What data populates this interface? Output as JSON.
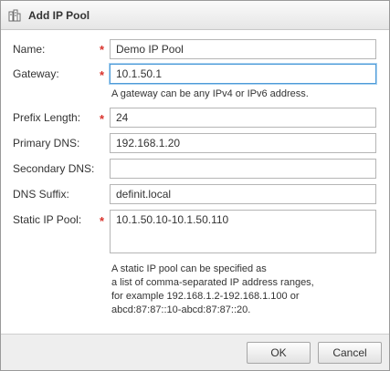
{
  "dialog": {
    "title": "Add IP Pool",
    "title_icon": "ip-pool-icon"
  },
  "form": {
    "name": {
      "label": "Name:",
      "required": true,
      "value": "Demo IP Pool"
    },
    "gateway": {
      "label": "Gateway:",
      "required": true,
      "value": "10.1.50.1",
      "hint": "A gateway can be any IPv4 or IPv6 address."
    },
    "prefix_length": {
      "label": "Prefix Length:",
      "required": true,
      "value": "24"
    },
    "primary_dns": {
      "label": "Primary DNS:",
      "required": false,
      "value": "192.168.1.20"
    },
    "secondary_dns": {
      "label": "Secondary DNS:",
      "required": false,
      "value": ""
    },
    "dns_suffix": {
      "label": "DNS Suffix:",
      "required": false,
      "value": "definit.local"
    },
    "static_ip_pool": {
      "label": "Static IP Pool:",
      "required": true,
      "value": "10.1.50.10-10.1.50.110",
      "hint_lines": [
        "A static IP pool can be specified as",
        "a list of comma-separated IP address ranges,",
        "for example 192.168.1.2-192.168.1.100 or",
        "abcd:87:87::10-abcd:87:87::20."
      ]
    }
  },
  "required_marker": "*",
  "buttons": {
    "ok": "OK",
    "cancel": "Cancel"
  },
  "colors": {
    "required": "#d9322b",
    "focus": "#4e9bd8"
  }
}
